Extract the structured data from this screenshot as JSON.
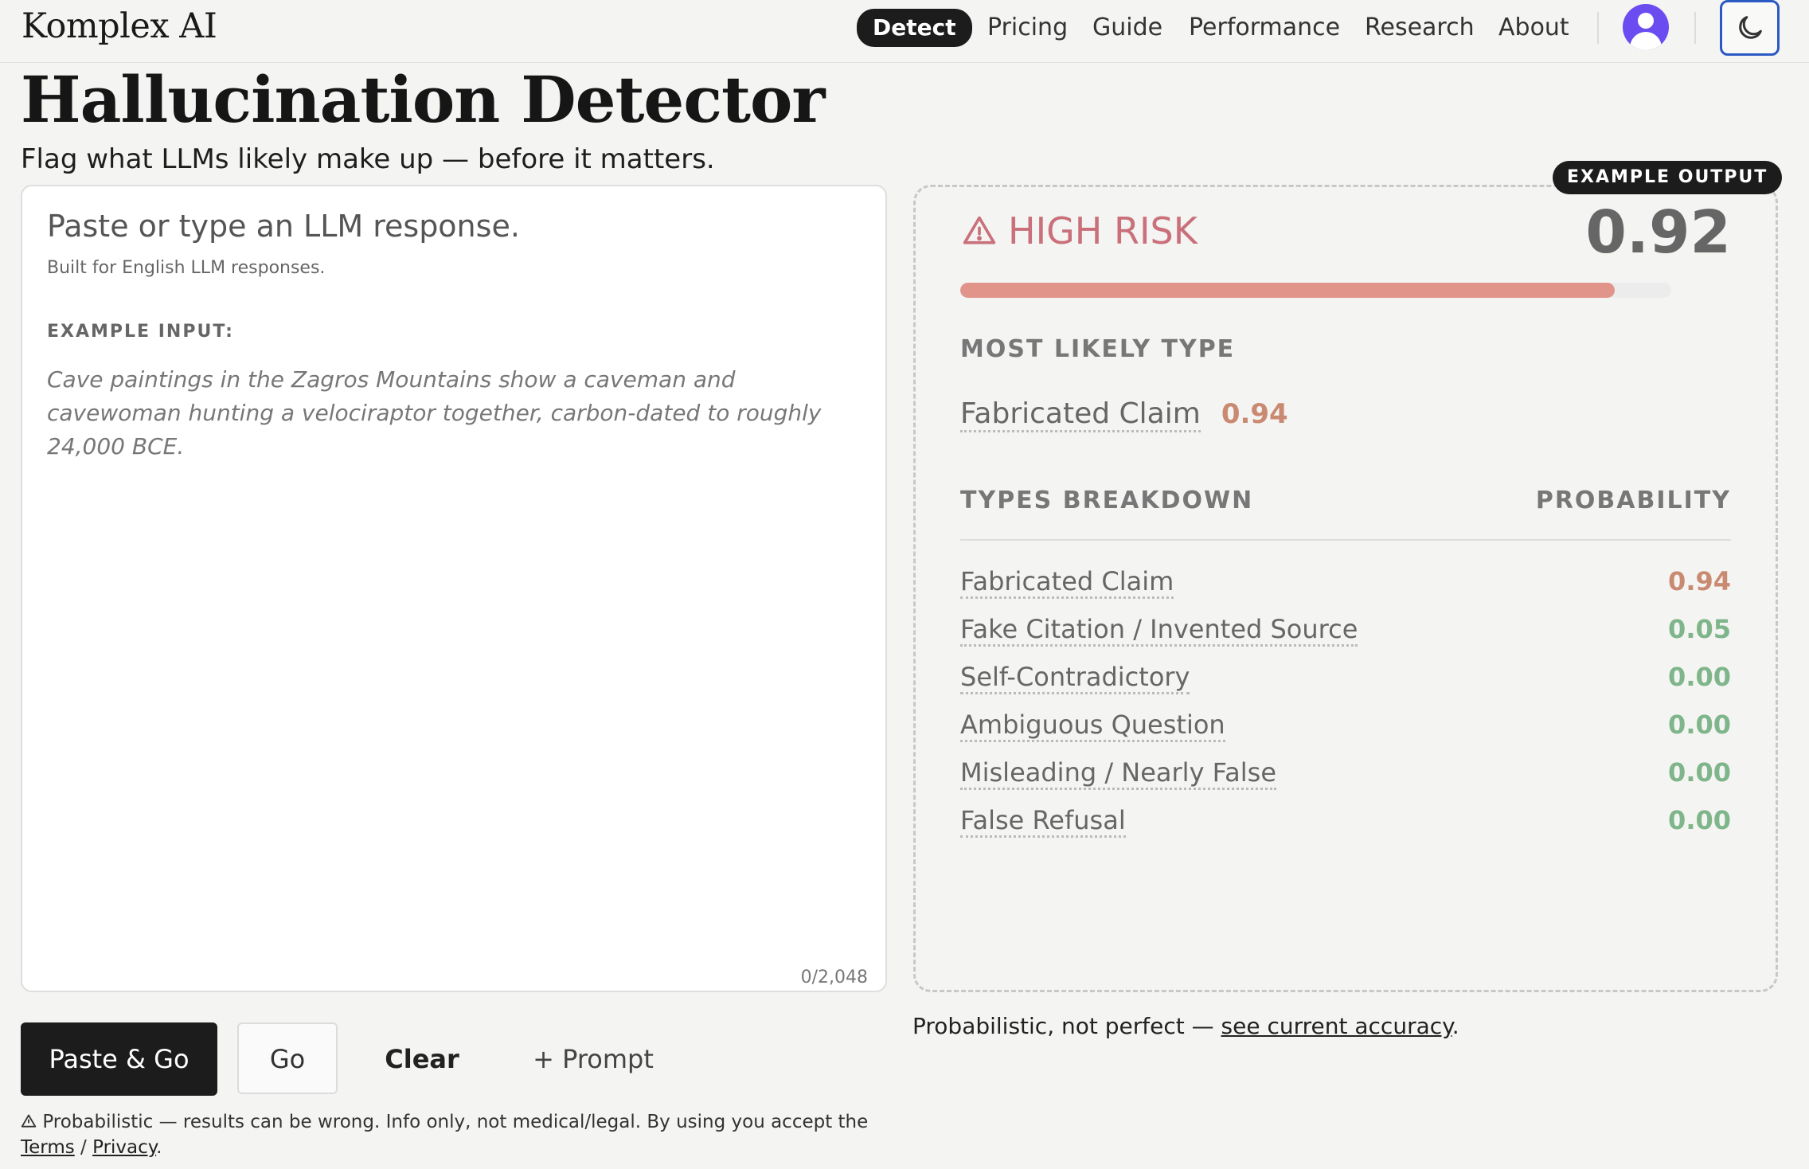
{
  "header": {
    "brand": "Komplex AI",
    "nav": [
      {
        "label": "Detect",
        "active": true
      },
      {
        "label": "Pricing"
      },
      {
        "label": "Guide"
      },
      {
        "label": "Performance"
      },
      {
        "label": "Research"
      },
      {
        "label": "About"
      }
    ],
    "avatar_icon": "user-avatar-icon",
    "theme_icon": "moon-icon"
  },
  "page": {
    "title": "Hallucination Detector",
    "subtitle": "Flag what LLMs likely make up — before it matters."
  },
  "input": {
    "placeholder": "Paste or type an LLM response.",
    "hint": "Built for English LLM responses.",
    "example_label": "EXAMPLE INPUT:",
    "example_text": "Cave paintings in the Zagros Mountains show a caveman and cavewoman hunting a velociraptor together, carbon-dated to roughly 24,000 BCE.",
    "char_count": "0/2,048"
  },
  "output": {
    "badge": "EXAMPLE OUTPUT",
    "risk_label": "HIGH RISK",
    "risk_icon": "warning-triangle-icon",
    "risk_score": "0.92",
    "risk_fraction": 0.92,
    "most_likely_label": "MOST LIKELY TYPE",
    "most_likely_type": "Fabricated Claim",
    "most_likely_prob": "0.94",
    "breakdown_label": "TYPES BREAKDOWN",
    "probability_label": "PROBABILITY",
    "types": [
      {
        "name": "Fabricated Claim",
        "prob": "0.94",
        "level": "high"
      },
      {
        "name": "Fake Citation / Invented Source",
        "prob": "0.05",
        "level": "low"
      },
      {
        "name": "Self-Contradictory",
        "prob": "0.00",
        "level": "low"
      },
      {
        "name": "Ambiguous Question",
        "prob": "0.00",
        "level": "low"
      },
      {
        "name": "Misleading / Nearly False",
        "prob": "0.00",
        "level": "low"
      },
      {
        "name": "False Refusal",
        "prob": "0.00",
        "level": "low"
      }
    ]
  },
  "accuracy_note": {
    "prefix": "Probabilistic, not perfect — ",
    "link": "see current accuracy",
    "suffix": "."
  },
  "actions": {
    "paste_go": "Paste & Go",
    "go": "Go",
    "clear": "Clear",
    "prompt": "+ Prompt"
  },
  "footer": {
    "warning_icon": "warning-triangle-icon",
    "text": "Probabilistic — results can be wrong. Info only, not medical/legal. By using you accept the",
    "terms": "Terms",
    "sep": "/",
    "privacy": "Privacy",
    "end": "."
  },
  "colors": {
    "risk_high": "#c9707a",
    "bar_fill": "#e0948a",
    "prob_high": "#c98a72",
    "prob_low": "#7fb58a",
    "accent_border": "#2b59c3",
    "avatar_bg": "#6a4cf0"
  }
}
